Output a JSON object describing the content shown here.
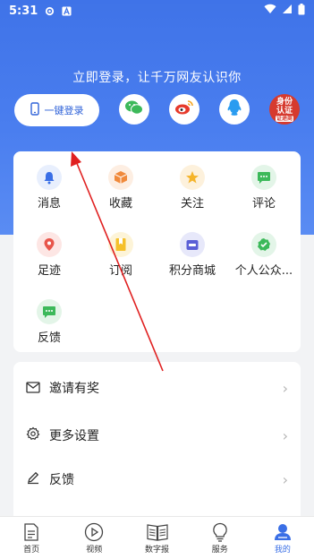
{
  "status_bar": {
    "time": "5:31"
  },
  "hero": {
    "tagline": "立即登录，让千万网友认识你"
  },
  "login": {
    "one_click_label": "一键登录",
    "auth_badge_line1": "身份",
    "auth_badge_line2": "认证",
    "auth_badge_line3": "证途商"
  },
  "grid": {
    "items": [
      {
        "label": "消息",
        "icon": "bell-icon",
        "color": "#3a6fe6"
      },
      {
        "label": "收藏",
        "icon": "box-icon",
        "color": "#f08a3c"
      },
      {
        "label": "关注",
        "icon": "star-icon",
        "color": "#f5b42a"
      },
      {
        "label": "评论",
        "icon": "comment-icon",
        "color": "#3cb95a"
      },
      {
        "label": "足迹",
        "icon": "location-icon",
        "color": "#e8554a"
      },
      {
        "label": "订阅",
        "icon": "bookmark-icon",
        "color": "#f5c02a"
      },
      {
        "label": "积分商城",
        "icon": "store-icon",
        "color": "#5b5fd6"
      },
      {
        "label": "个人公众...",
        "icon": "verified-icon",
        "color": "#3cb95a"
      },
      {
        "label": "反馈",
        "icon": "feedback-icon",
        "color": "#3cb95a"
      }
    ]
  },
  "list": {
    "items": [
      {
        "label": "邀请有奖",
        "icon": "mail-icon"
      },
      {
        "label": "更多设置",
        "icon": "gear-icon"
      },
      {
        "label": "反馈",
        "icon": "pencil-icon"
      }
    ]
  },
  "tabbar": {
    "tabs": [
      {
        "label": "首页",
        "icon": "home-doc-icon"
      },
      {
        "label": "视频",
        "icon": "play-icon"
      },
      {
        "label": "数字报",
        "icon": "newspaper-icon"
      },
      {
        "label": "服务",
        "icon": "bulb-icon"
      },
      {
        "label": "我的",
        "icon": "user-icon",
        "active": true
      }
    ]
  },
  "colors": {
    "accent": "#3a6fe6",
    "hero_top": "#3f73e8",
    "annotation": "#e02020"
  }
}
